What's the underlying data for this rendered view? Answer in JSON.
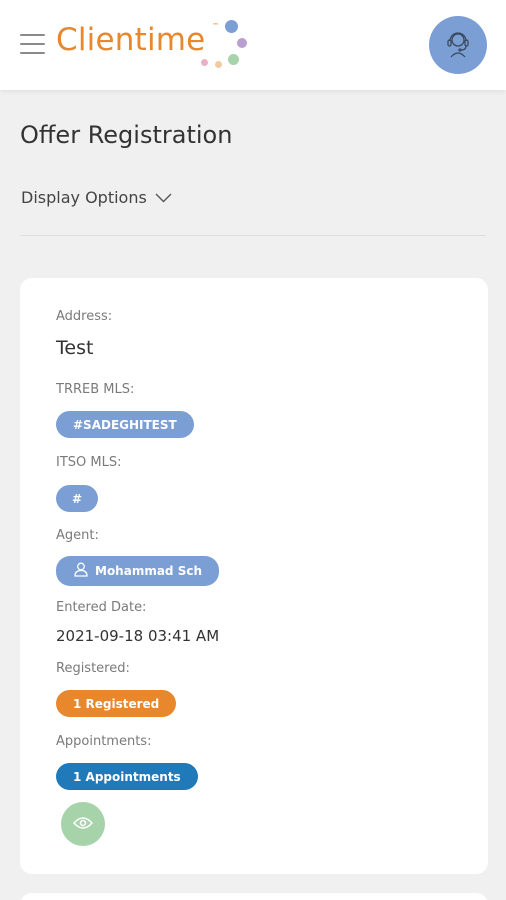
{
  "app": {
    "logo_text": "Clientime",
    "logo_tm": "™"
  },
  "page": {
    "title": "Offer Registration",
    "display_options_label": "Display Options"
  },
  "record": {
    "address_label": "Address:",
    "address_value": "Test",
    "trreb_label": "TRREB MLS:",
    "trreb_value": "#SADEGHITEST",
    "itso_label": "ITSO MLS:",
    "itso_value": "#",
    "agent_label": "Agent:",
    "agent_value": "Mohammad Sch",
    "entered_label": "Entered Date:",
    "entered_value": "2021-09-18 03:41 AM",
    "registered_label": "Registered:",
    "registered_value": "1 Registered",
    "appointments_label": "Appointments:",
    "appointments_value": "1 Appointments"
  },
  "icons": {
    "menu": "hamburger-icon",
    "support": "headset-icon",
    "chevron": "chevron-down-icon",
    "agent": "user-icon",
    "view": "eye-icon"
  },
  "colors": {
    "brand_orange": "#e8872b",
    "pill_blue": "#7b9fd4",
    "pill_orange": "#e8872b",
    "pill_dark_blue": "#2079b8",
    "view_green": "#a6d3a9",
    "background": "#f0f0f0"
  }
}
